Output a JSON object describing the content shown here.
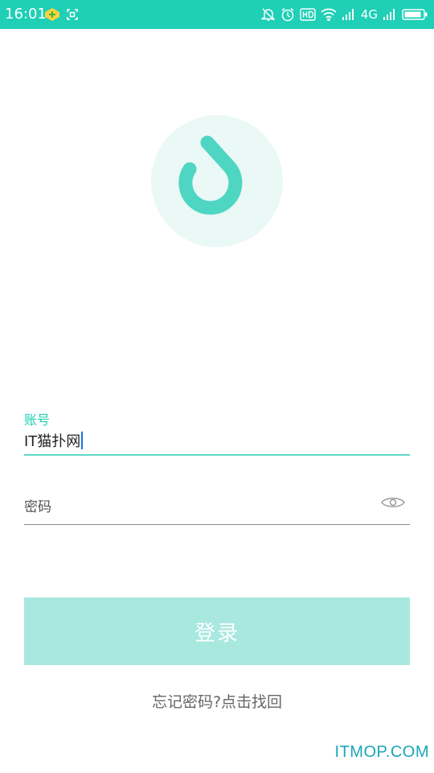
{
  "status_bar": {
    "time": "16:01",
    "network": "4G",
    "icons": [
      "app-badge-icon",
      "scan-icon",
      "mute-bell-icon",
      "alarm-icon",
      "hd-icon",
      "wifi-icon",
      "signal-icon",
      "battery-icon"
    ]
  },
  "colors": {
    "accent": "#1fcfb6",
    "button_disabled": "#a8e8df",
    "logo_bg": "#eaf8f6"
  },
  "form": {
    "account_label": "账号",
    "account_value": "IT猫扑网",
    "password_placeholder": "密码",
    "login_label": "登录"
  },
  "forgot": {
    "prefix": "忘记密码?",
    "link": "点击找回"
  },
  "watermark": "ITMOP.COM"
}
